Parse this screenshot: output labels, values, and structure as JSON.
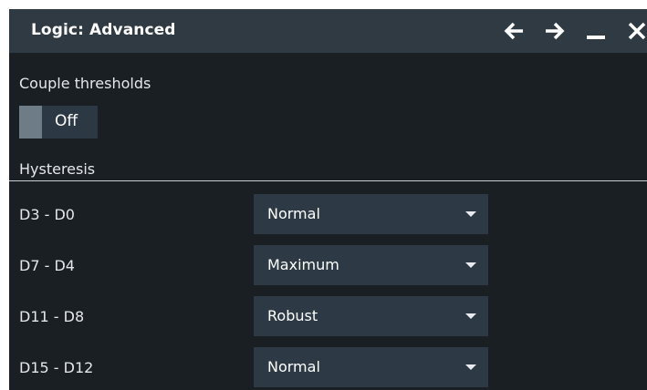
{
  "window": {
    "title": "Logic: Advanced",
    "buttons": [
      "back-arrow-icon",
      "forward-arrow-icon",
      "minimize-icon",
      "close-icon"
    ]
  },
  "couple_thresholds": {
    "label": "Couple thresholds",
    "toggle_value": "Off"
  },
  "hysteresis": {
    "section_label": "Hysteresis",
    "rows": [
      {
        "label": "D3 - D0",
        "value": "Normal"
      },
      {
        "label": "D7 - D4",
        "value": "Maximum"
      },
      {
        "label": "D11 - D8",
        "value": "Robust"
      },
      {
        "label": "D15 - D12",
        "value": "Normal"
      }
    ]
  },
  "colors": {
    "titlebar": "#2f3a43",
    "background": "#1a1f24",
    "control": "#2d3a46",
    "toggle_knob": "#6e7c88"
  }
}
